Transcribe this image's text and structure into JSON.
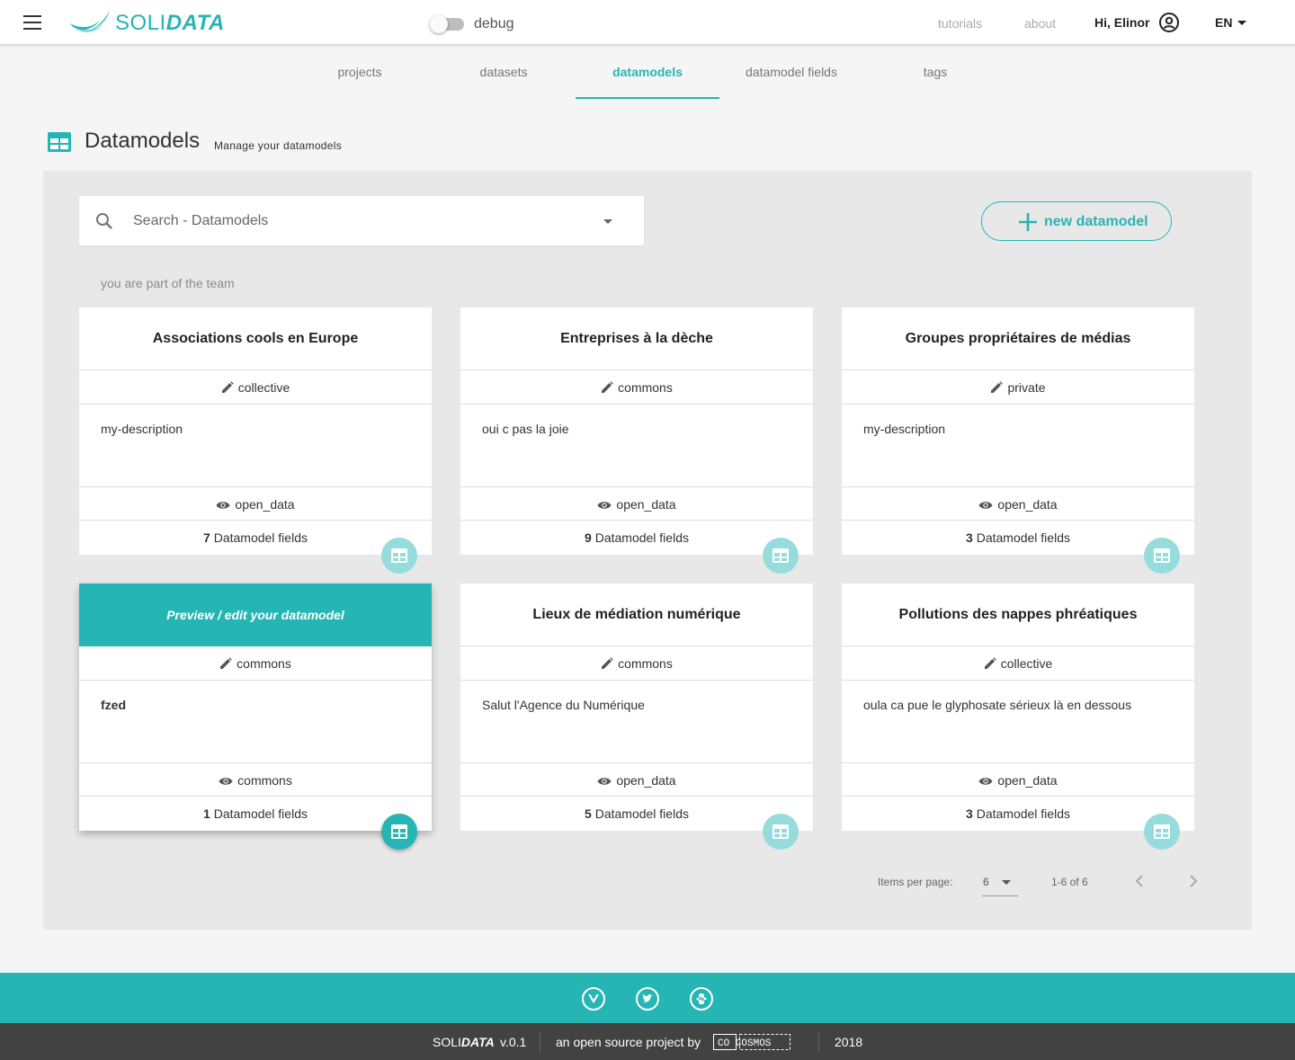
{
  "header": {
    "logo_text_light": "SOLI",
    "logo_text_bold": "DATA",
    "debug_label": "debug",
    "links": [
      {
        "label": "tutorials"
      },
      {
        "label": "about"
      }
    ],
    "greeting": "Hi, Elinor",
    "language": "EN"
  },
  "tabs": [
    {
      "label": "projects",
      "active": false
    },
    {
      "label": "datasets",
      "active": false
    },
    {
      "label": "datamodels",
      "active": true
    },
    {
      "label": "datamodel fields",
      "active": false
    },
    {
      "label": "tags",
      "active": false
    }
  ],
  "page": {
    "title": "Datamodels",
    "subtitle": "Manage your datamodels"
  },
  "search": {
    "placeholder": "Search - Datamodels"
  },
  "new_button": {
    "label": "new datamodel"
  },
  "team_label": "you are part of the team",
  "cards": [
    {
      "title": "Associations cools en Europe",
      "license": "collective",
      "description": "my-description",
      "open_level": "open_data",
      "fields_count": "7",
      "fields_label": "Datamodel fields"
    },
    {
      "title": "Entreprises à la dèche",
      "license": "commons",
      "description": "oui c pas la joie",
      "open_level": "open_data",
      "fields_count": "9",
      "fields_label": "Datamodel fields"
    },
    {
      "title": "Groupes propriétaires de médias",
      "license": "private",
      "description": "my-description",
      "open_level": "open_data",
      "fields_count": "3",
      "fields_label": "Datamodel fields"
    },
    {
      "title": "Preview / edit your datamodel",
      "license": "commons",
      "description": "fzed",
      "open_level": "commons",
      "fields_count": "1",
      "fields_label": "Datamodel fields"
    },
    {
      "title": "Lieux de médiation numérique",
      "license": "commons",
      "description": "Salut l'Agence du Numérique",
      "open_level": "open_data",
      "fields_count": "5",
      "fields_label": "Datamodel fields"
    },
    {
      "title": "Pollutions des nappes phréatiques",
      "license": "collective",
      "description": "oula ca pue le glyphosate sérieux là en dessous",
      "open_level": "open_data",
      "fields_count": "3",
      "fields_label": "Datamodel fields"
    }
  ],
  "pagination": {
    "items_per_page_label": "Items per page:",
    "items_per_page": "6",
    "range": "1-6 of 6"
  },
  "footer": {
    "social_icons": [
      "vue-icon",
      "twitter-icon",
      "python-icon"
    ],
    "brand_light": "SOLI",
    "brand_bold": "DATA",
    "version": "v.0.1",
    "open_source_text": "an open source project by",
    "cosmos_logo_text": "CO COSMOS",
    "year": "2018"
  },
  "colors": {
    "accent": "#26b5b5",
    "accent_light": "#96dcdc",
    "footer_dark": "#424242",
    "panel_bg": "#e8e8e8"
  }
}
